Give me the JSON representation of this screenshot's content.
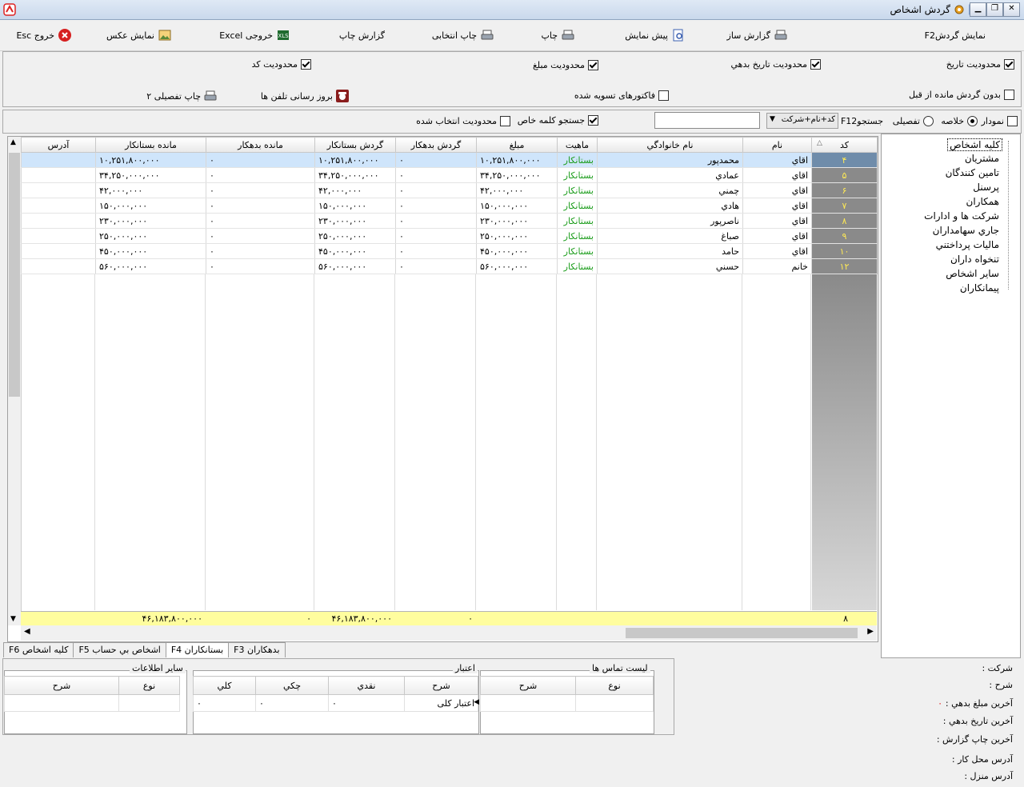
{
  "window": {
    "title": "گردش اشخاص"
  },
  "toolbar": {
    "show_turnover": "نمايش گردشF2",
    "report_builder": "گزارش ساز",
    "preview": "پيش نمايش",
    "print": "چاپ",
    "print_selected": "چاپ انتخابی",
    "print_report": "گزارش چاپ",
    "excel": "خروجی Excel",
    "show_photo": "نمايش عکس",
    "exit": "خروج Esc"
  },
  "options": {
    "date_limit": "محدوديت تاريخ",
    "debt_date_limit": "محدوديت تاريخ بدهي",
    "amount_limit": "محدوديت مبلغ",
    "code_limit": "محدوديت کد",
    "no_prev_balance": "بدون گردش مانده از قبل",
    "settled_invoices": "فاكتورهاى تسويه شده",
    "phone_update": "بروز رسانی تلفن ها",
    "print_detail2": "چاپ تفصيلی ۲"
  },
  "search": {
    "chart": "نمودار",
    "summary": "خلاصه",
    "detailed": "تفصيلی",
    "search_label": "F12جستجو",
    "search_field": "کد+نام+شرکت",
    "special_keyword": "جستجو کلمه خاص",
    "selected_limit": "محدوديت انتخاب شده"
  },
  "grid": {
    "headers": {
      "code": "کد",
      "sort": "△",
      "name": "نام",
      "family": "نام خانوادگي",
      "nature": "ماهيت",
      "amount": "مبلغ",
      "debit_turnover": "گردش بدهکار",
      "credit_turnover": "گردش بستانکار",
      "debit_balance": "مانده بدهکار",
      "credit_balance": "مانده بستانکار",
      "address": "آدرس"
    },
    "rows": [
      {
        "code": "۴",
        "name": "اقاي",
        "family": "محمدپور",
        "nature": "بستانکار",
        "amount": "۱۰,۲۵۱,۸۰۰,۰۰۰",
        "debit_turnover": "۰",
        "credit_turnover": "۱۰,۲۵۱,۸۰۰,۰۰۰",
        "debit_balance": "۰",
        "credit_balance": "۱۰,۲۵۱,۸۰۰,۰۰۰",
        "address": ""
      },
      {
        "code": "۵",
        "name": "اقاي",
        "family": "عمادي",
        "nature": "بستانکار",
        "amount": "۳۴,۲۵۰,۰۰۰,۰۰۰",
        "debit_turnover": "۰",
        "credit_turnover": "۳۴,۲۵۰,۰۰۰,۰۰۰",
        "debit_balance": "۰",
        "credit_balance": "۳۴,۲۵۰,۰۰۰,۰۰۰",
        "address": ""
      },
      {
        "code": "۶",
        "name": "اقاي",
        "family": "چمني",
        "nature": "بستانکار",
        "amount": "۴۲,۰۰۰,۰۰۰",
        "debit_turnover": "۰",
        "credit_turnover": "۴۲,۰۰۰,۰۰۰",
        "debit_balance": "۰",
        "credit_balance": "۴۲,۰۰۰,۰۰۰",
        "address": ""
      },
      {
        "code": "۷",
        "name": "اقاي",
        "family": "هادي",
        "nature": "بستانکار",
        "amount": "۱۵۰,۰۰۰,۰۰۰",
        "debit_turnover": "۰",
        "credit_turnover": "۱۵۰,۰۰۰,۰۰۰",
        "debit_balance": "۰",
        "credit_balance": "۱۵۰,۰۰۰,۰۰۰",
        "address": ""
      },
      {
        "code": "۸",
        "name": "اقاي",
        "family": "ناصرپور",
        "nature": "بستانکار",
        "amount": "۲۳۰,۰۰۰,۰۰۰",
        "debit_turnover": "۰",
        "credit_turnover": "۲۳۰,۰۰۰,۰۰۰",
        "debit_balance": "۰",
        "credit_balance": "۲۳۰,۰۰۰,۰۰۰",
        "address": ""
      },
      {
        "code": "۹",
        "name": "اقاي",
        "family": "صباغ",
        "nature": "بستانکار",
        "amount": "۲۵۰,۰۰۰,۰۰۰",
        "debit_turnover": "۰",
        "credit_turnover": "۲۵۰,۰۰۰,۰۰۰",
        "debit_balance": "۰",
        "credit_balance": "۲۵۰,۰۰۰,۰۰۰",
        "address": ""
      },
      {
        "code": "۱۰",
        "name": "اقاي",
        "family": "حامد",
        "nature": "بستانکار",
        "amount": "۴۵۰,۰۰۰,۰۰۰",
        "debit_turnover": "۰",
        "credit_turnover": "۴۵۰,۰۰۰,۰۰۰",
        "debit_balance": "۰",
        "credit_balance": "۴۵۰,۰۰۰,۰۰۰",
        "address": ""
      },
      {
        "code": "۱۲",
        "name": "خانم",
        "family": "حسني",
        "nature": "بستانکار",
        "amount": "۵۶۰,۰۰۰,۰۰۰",
        "debit_turnover": "۰",
        "credit_turnover": "۵۶۰,۰۰۰,۰۰۰",
        "debit_balance": "۰",
        "credit_balance": "۵۶۰,۰۰۰,۰۰۰",
        "address": ""
      }
    ],
    "totals": {
      "count": "۸",
      "debit_turnover": "۰",
      "credit_turnover": "۴۶,۱۸۳,۸۰۰,۰۰۰",
      "debit_balance": "۰",
      "credit_balance": "۴۶,۱۸۳,۸۰۰,۰۰۰"
    }
  },
  "tree": {
    "items": [
      "کليه اشخاص",
      "مشتريان",
      "تامين کنندگان",
      "پرسنل",
      "همكاران",
      "شرکت ها و ادارات",
      "جاري سهامداران",
      "ماليات پرداختني",
      "تنخواه داران",
      "ساير اشخاص",
      "پيمانكاران"
    ]
  },
  "tabs": [
    "بدهکاران F3",
    "بستانکاران F4",
    "اشخاص بي حساب F5",
    "کليه اشخاص F6"
  ],
  "contacts": {
    "title": "ليست تماس ها",
    "col_type": "نوع",
    "col_desc": "شرح"
  },
  "credit": {
    "title": "اعتبار",
    "col_desc": "شرح",
    "col_cash": "نقدي",
    "col_check": "چكي",
    "col_total": "كلي",
    "row_label": "اعتبار کلی",
    "cash": "۰",
    "check": "۰",
    "total": "۰"
  },
  "other": {
    "title": "ساير اطلاعات",
    "col_type": "نوع",
    "col_desc": "شرح"
  },
  "info": {
    "company": "شركت :",
    "desc": "شرح :",
    "last_debt_amount": "آخرين مبلغ بدهي :",
    "last_debt_amount_value": "۰",
    "last_debt_date": "آخرين تاريخ بدهي :",
    "last_print": "آخرين چاپ گزارش :",
    "work_address": "آدرس محل كار :",
    "home_address": "آدرس منزل :"
  },
  "colors": {
    "accent_selected": "#cfe5fb",
    "code_column": "#8a8a8a",
    "code_text": "#ffea55",
    "status_green": "#1a9c1a",
    "totals_row": "#fffd9e"
  }
}
